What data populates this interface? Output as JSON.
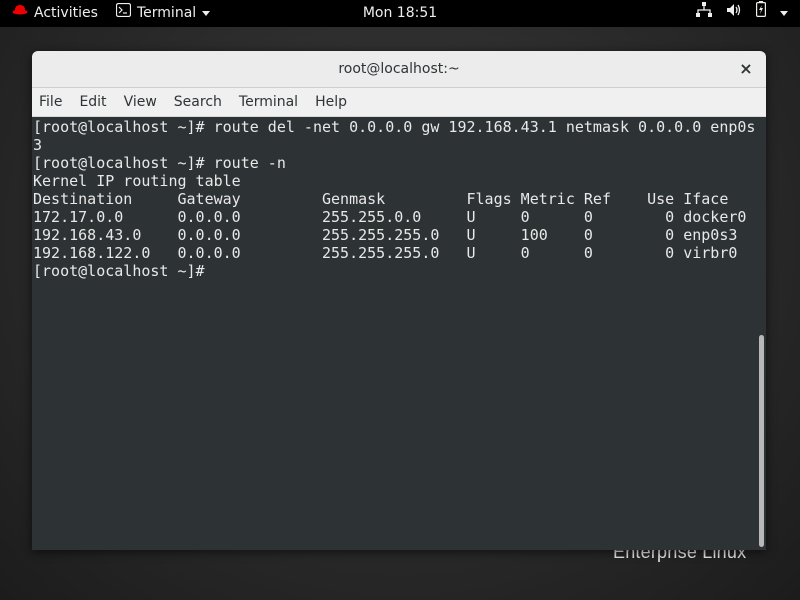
{
  "topbar": {
    "activities": "Activities",
    "app_name": "Terminal",
    "clock": "Mon 18:51",
    "icons": [
      "redhat-logo-icon",
      "terminal-app-icon",
      "network-icon",
      "volume-icon",
      "battery-icon",
      "system-menu-arrow-icon"
    ]
  },
  "window": {
    "title": "root@localhost:~",
    "close_glyph": "×",
    "menu": [
      "File",
      "Edit",
      "View",
      "Search",
      "Terminal",
      "Help"
    ]
  },
  "terminal": {
    "lines": [
      "[root@localhost ~]# route del -net 0.0.0.0 gw 192.168.43.1 netmask 0.0.0.0 enp0s",
      "3",
      "[root@localhost ~]# route -n",
      "Kernel IP routing table",
      "Destination     Gateway         Genmask         Flags Metric Ref    Use Iface",
      "172.17.0.0      0.0.0.0         255.255.0.0     U     0      0        0 docker0",
      "192.168.43.0    0.0.0.0         255.255.255.0   U     100    0        0 enp0s3",
      "192.168.122.0   0.0.0.0         255.255.255.0   U     0      0        0 virbr0",
      "[root@localhost ~]# "
    ]
  },
  "wallpaper": {
    "branding": "Enterprise Linux"
  },
  "colors": {
    "topbar": "#000000",
    "terminal_bg": "#2d3335",
    "redhat_red": "#ee0000"
  }
}
